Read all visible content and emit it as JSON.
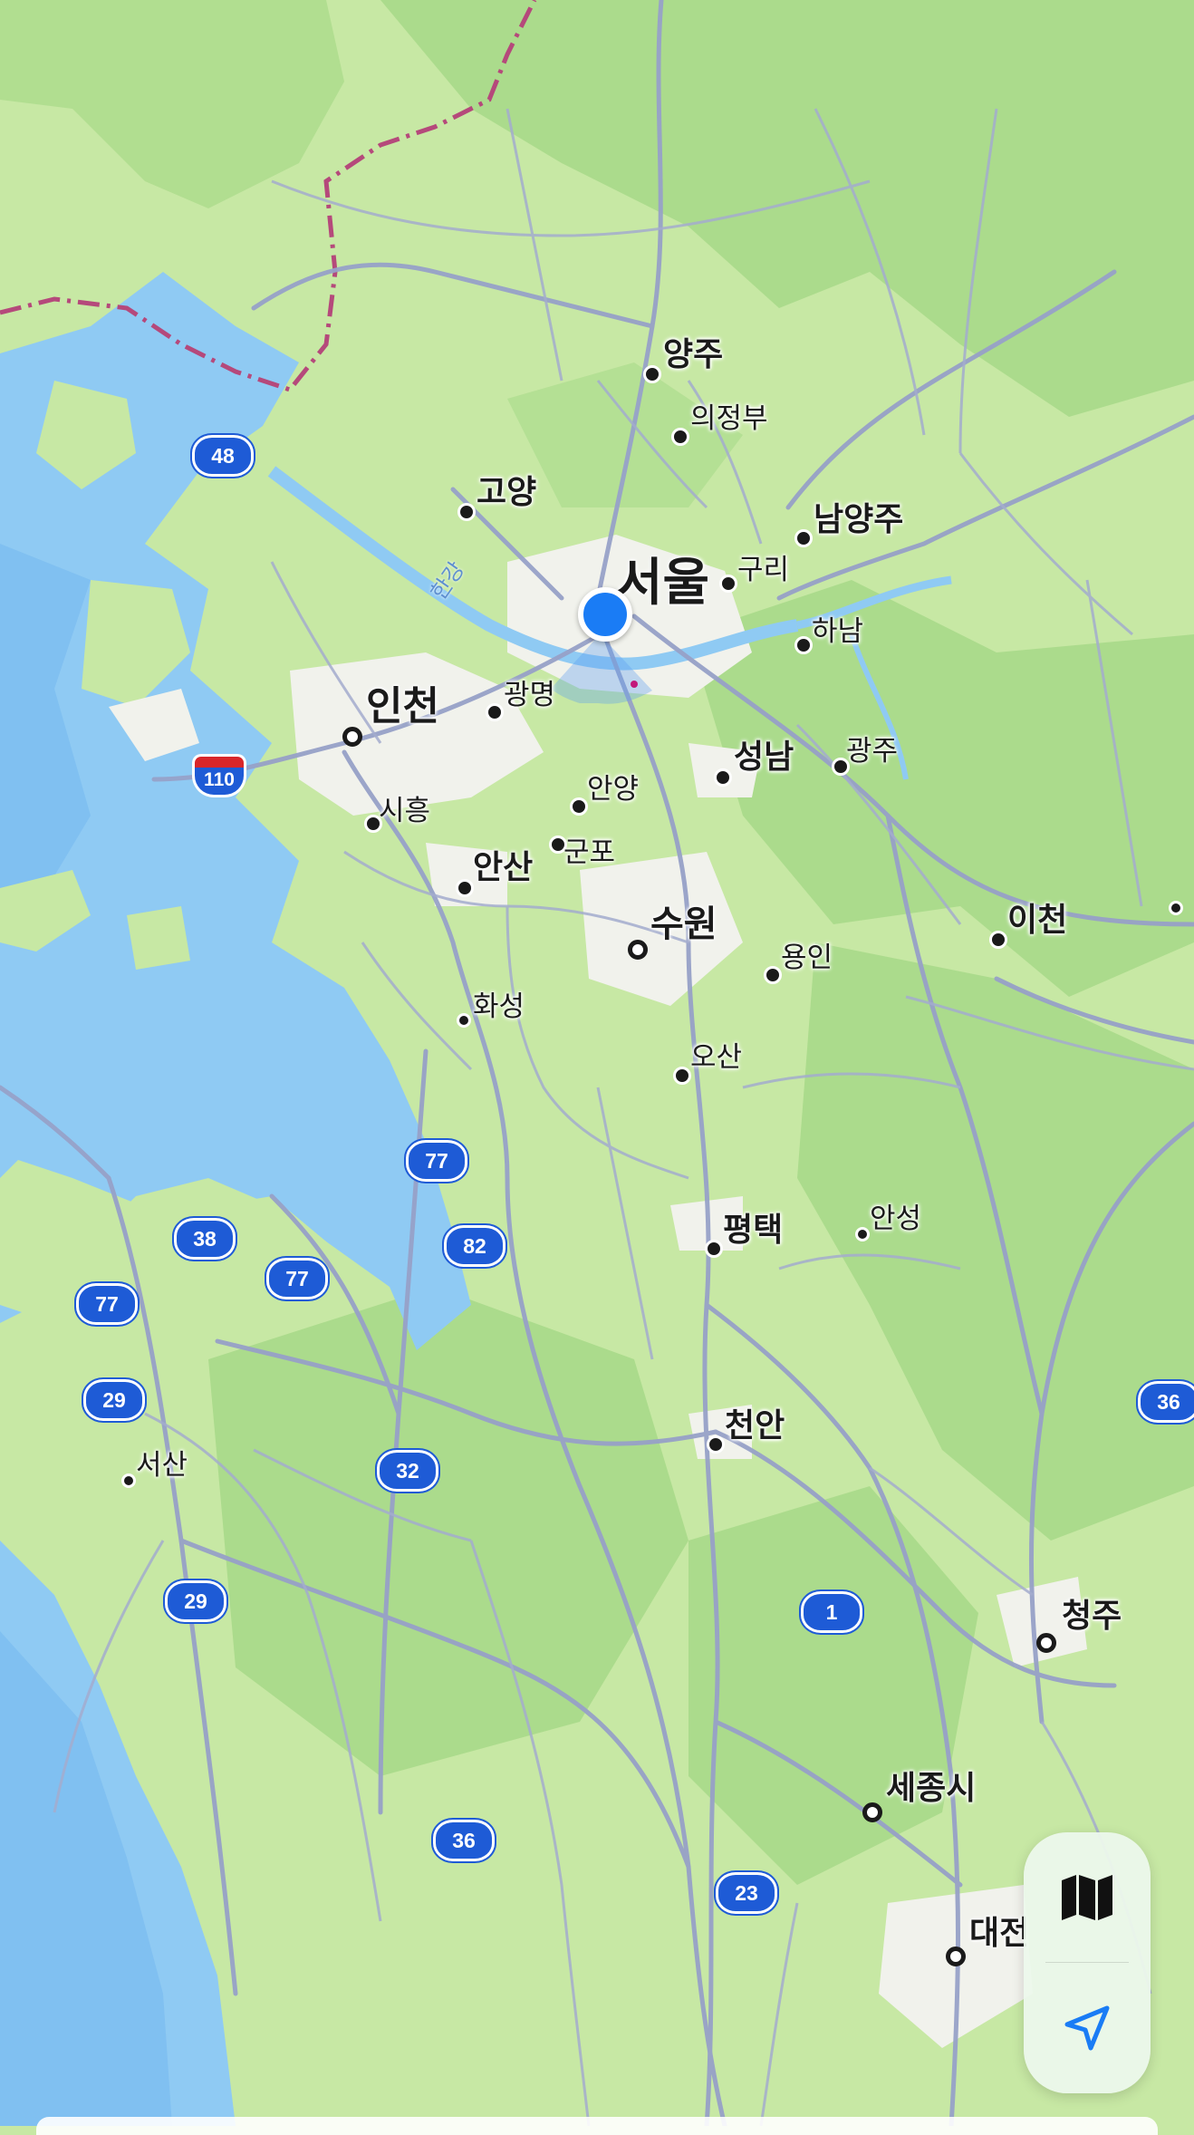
{
  "map": {
    "colors": {
      "land": "#c7e8a4",
      "forest": "#a6d888",
      "water": "#8fc9f4",
      "deep_water": "#6db7ee",
      "urban": "#f2f2ee",
      "road": "#9aa3c6",
      "border": "#b5497b",
      "user_location": "#1a7cf5"
    },
    "cities": [
      {
        "name": "서울",
        "tier": "major"
      },
      {
        "name": "인천",
        "tier": "major"
      },
      {
        "name": "수원",
        "tier": "large"
      },
      {
        "name": "성남",
        "tier": "large"
      },
      {
        "name": "평택",
        "tier": "large"
      },
      {
        "name": "천안",
        "tier": "large"
      },
      {
        "name": "청주",
        "tier": "large"
      },
      {
        "name": "세종시",
        "tier": "large"
      },
      {
        "name": "대전",
        "tier": "large"
      },
      {
        "name": "안산",
        "tier": "large"
      },
      {
        "name": "고양",
        "tier": "large"
      },
      {
        "name": "양주",
        "tier": "large"
      },
      {
        "name": "남양주",
        "tier": "large"
      },
      {
        "name": "이천",
        "tier": "large"
      },
      {
        "name": "의정부",
        "tier": "medium"
      },
      {
        "name": "구리",
        "tier": "medium"
      },
      {
        "name": "하남",
        "tier": "medium"
      },
      {
        "name": "광명",
        "tier": "medium"
      },
      {
        "name": "광주",
        "tier": "medium"
      },
      {
        "name": "안양",
        "tier": "medium"
      },
      {
        "name": "시흥",
        "tier": "medium"
      },
      {
        "name": "군포",
        "tier": "medium"
      },
      {
        "name": "용인",
        "tier": "medium"
      },
      {
        "name": "화성",
        "tier": "medium"
      },
      {
        "name": "오산",
        "tier": "medium"
      },
      {
        "name": "안성",
        "tier": "medium"
      },
      {
        "name": "서산",
        "tier": "medium"
      }
    ],
    "river_label": "한강",
    "route_shields": [
      "48",
      "77",
      "82",
      "38",
      "77",
      "77",
      "29",
      "32",
      "29",
      "1",
      "36",
      "23",
      "36"
    ],
    "expressway_shields": [
      "110"
    ]
  },
  "controls": {
    "map_mode_icon": "map-icon",
    "locate_icon": "location-arrow-icon"
  }
}
